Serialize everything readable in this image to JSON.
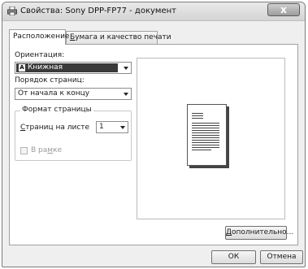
{
  "window": {
    "title": "Свойства: Sony DPP-FP77 - документ",
    "close_glyph": "x"
  },
  "tabs": [
    {
      "label": "Расположение",
      "active": true
    },
    {
      "label_accel": "Б",
      "label_rest": "умага и качество печати",
      "active": false
    }
  ],
  "layout": {
    "orientation_label": "Ориентация:",
    "orientation_value": "Книжная",
    "orientation_glyph": "A",
    "page_order_label": "Порядок страниц:",
    "page_order_value": "От начала к концу",
    "page_format_group": "Формат страницы",
    "pages_per_sheet_label_accel": "С",
    "pages_per_sheet_label_rest": "траниц на листе",
    "pages_per_sheet_value": "1",
    "border_label_pre": "В ра",
    "border_label_accel": "м",
    "border_label_post": "ке",
    "border_checked": false
  },
  "buttons": {
    "advanced_accel": "Д",
    "advanced_rest": "ополнительно...",
    "ok": "ОК",
    "cancel": "Отмена"
  },
  "icons": {
    "title": "printer-icon",
    "close": "close-icon",
    "dropdown": "chevron-down-icon"
  }
}
